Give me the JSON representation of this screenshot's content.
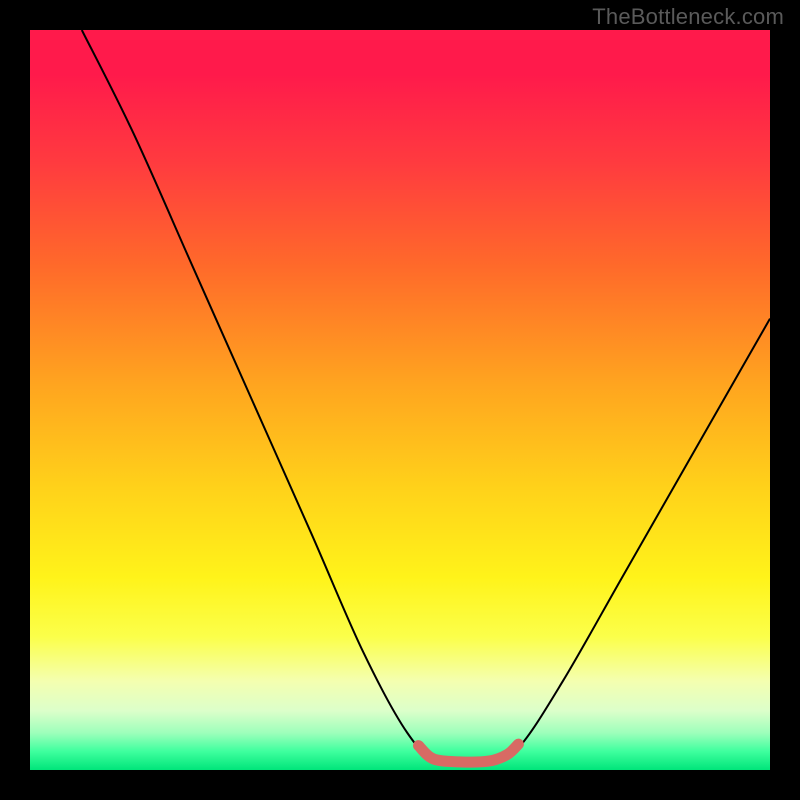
{
  "watermark": "TheBottleneck.com",
  "chart_data": {
    "type": "line",
    "title": "",
    "xlabel": "",
    "ylabel": "",
    "xlim": [
      0,
      100
    ],
    "ylim": [
      0,
      100
    ],
    "series": [
      {
        "name": "bottleneck-curve",
        "color": "#000000",
        "stroke_width": 2,
        "points": [
          {
            "x": 7,
            "y": 100
          },
          {
            "x": 14,
            "y": 86
          },
          {
            "x": 22,
            "y": 68
          },
          {
            "x": 30,
            "y": 50
          },
          {
            "x": 38,
            "y": 32
          },
          {
            "x": 45,
            "y": 16
          },
          {
            "x": 51,
            "y": 5
          },
          {
            "x": 55,
            "y": 1.5
          },
          {
            "x": 62,
            "y": 1.2
          },
          {
            "x": 66,
            "y": 3
          },
          {
            "x": 72,
            "y": 12
          },
          {
            "x": 80,
            "y": 26
          },
          {
            "x": 88,
            "y": 40
          },
          {
            "x": 96,
            "y": 54
          },
          {
            "x": 100,
            "y": 61
          }
        ]
      },
      {
        "name": "optimal-zone-overlay",
        "color": "#d86a64",
        "stroke_width": 11,
        "linecap": "round",
        "points": [
          {
            "x": 52.5,
            "y": 3.3
          },
          {
            "x": 54.5,
            "y": 1.5
          },
          {
            "x": 58,
            "y": 1.1
          },
          {
            "x": 62,
            "y": 1.2
          },
          {
            "x": 64.5,
            "y": 2.1
          },
          {
            "x": 66,
            "y": 3.5
          }
        ]
      }
    ],
    "background_gradient": {
      "direction": "vertical",
      "stops": [
        {
          "pos": 0.0,
          "color": "#ff1a4b"
        },
        {
          "pos": 0.18,
          "color": "#ff3b3f"
        },
        {
          "pos": 0.32,
          "color": "#ff6a2a"
        },
        {
          "pos": 0.48,
          "color": "#ffa51f"
        },
        {
          "pos": 0.62,
          "color": "#ffd21a"
        },
        {
          "pos": 0.74,
          "color": "#fff31a"
        },
        {
          "pos": 0.88,
          "color": "#f4ffb0"
        },
        {
          "pos": 0.95,
          "color": "#9dffbb"
        },
        {
          "pos": 1.0,
          "color": "#00e57a"
        }
      ]
    }
  }
}
